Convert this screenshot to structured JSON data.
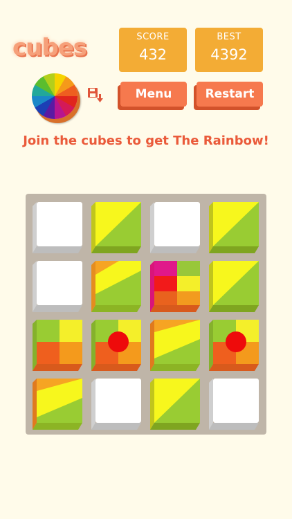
{
  "header": {
    "logo_text": "cubes",
    "score_label": "SCORE",
    "score_value": "432",
    "best_label": "BEST",
    "best_value": "4392"
  },
  "controls": {
    "menu_label": "Menu",
    "restart_label": "Restart",
    "save_icon": "save-download-icon",
    "wheel_icon": "color-wheel-icon"
  },
  "tagline": "Join the cubes to get The Rainbow!",
  "board": {
    "rows": [
      [
        "empty",
        "yellow-green",
        "empty",
        "yellow-green"
      ],
      [
        "empty",
        "yellow-green-stripe",
        "red-quad",
        "yellow-green"
      ],
      [
        "orange-quad",
        "orange-quad-dot",
        "yellow-orange-stripe",
        "orange-quad-dot"
      ],
      [
        "yellow-orange-stripe",
        "empty",
        "yellow-green",
        "empty"
      ]
    ]
  },
  "colors": {
    "background": "#fffbea",
    "score_box": "#f3ac35",
    "button": "#f6794e",
    "tagline": "#ea5a3a",
    "board": "#bfb5a8"
  }
}
